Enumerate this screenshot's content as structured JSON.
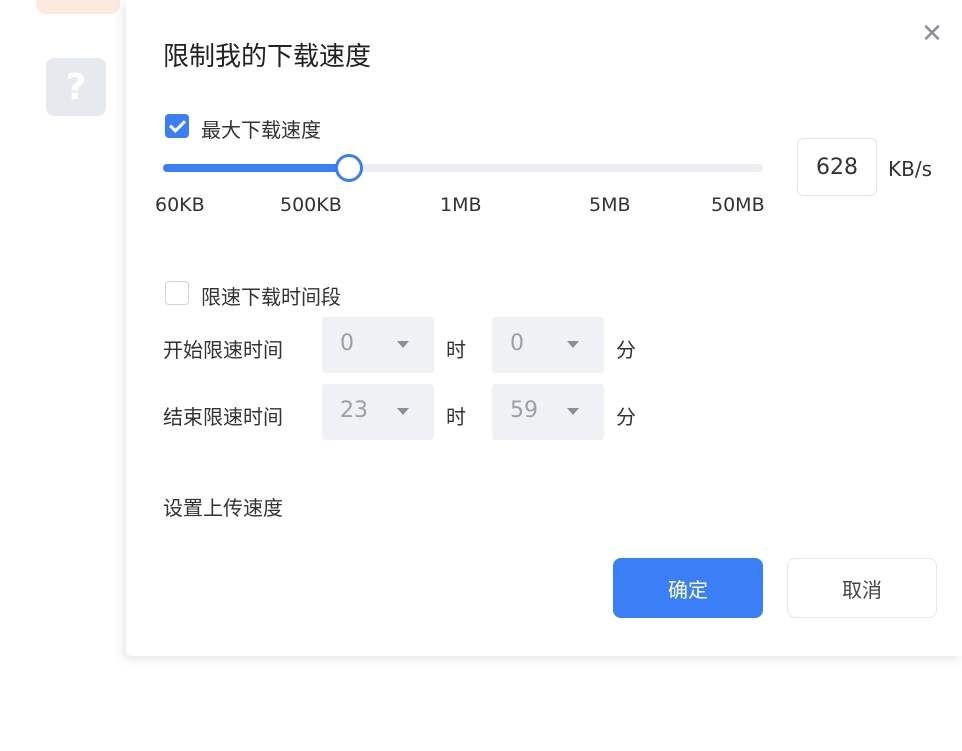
{
  "help": {
    "glyph": "?"
  },
  "dialog": {
    "title": "限制我的下载速度",
    "close_glyph": "✕",
    "max_speed": {
      "checked": true,
      "label": "最大下载速度",
      "ticks": [
        "60KB",
        "500KB",
        "1MB",
        "5MB",
        "50MB"
      ],
      "value": "628",
      "unit": "KB/s"
    },
    "time_limit": {
      "checked": false,
      "label": "限速下载时间段",
      "start_label": "开始限速时间",
      "end_label": "结束限速时间",
      "hour_unit": "时",
      "minute_unit": "分",
      "start_hour": "0",
      "start_minute": "0",
      "end_hour": "23",
      "end_minute": "59"
    },
    "upload_link": "设置上传速度",
    "confirm": "确定",
    "cancel": "取消"
  },
  "colors": {
    "accent": "#3a7ff6",
    "select_bg": "#f0f1f4"
  }
}
